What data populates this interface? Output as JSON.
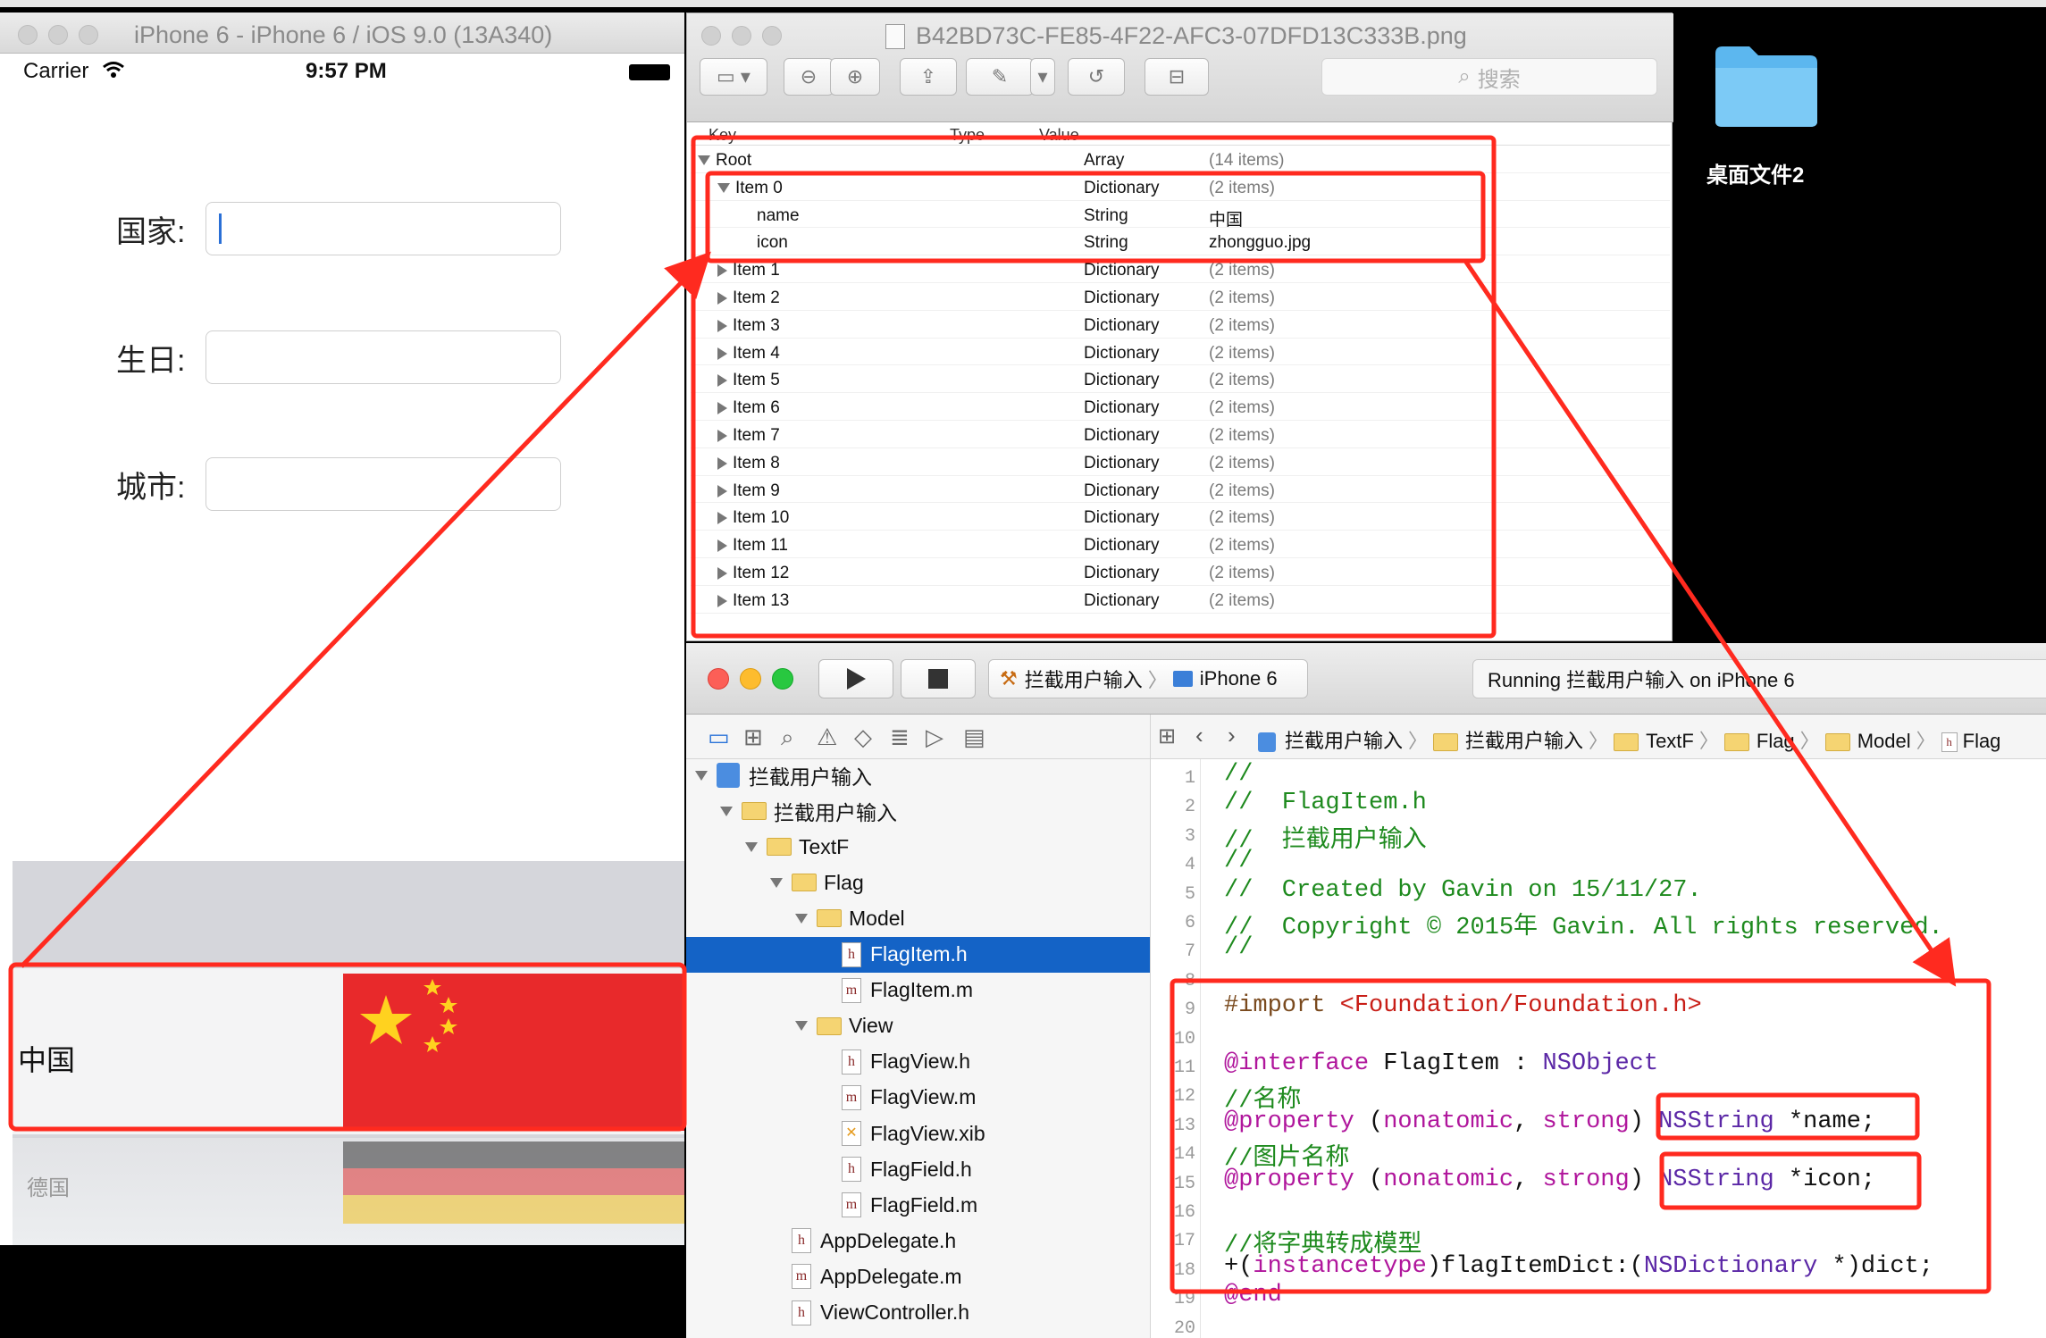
{
  "simulator": {
    "title": "iPhone 6 - iPhone 6 / iOS 9.0 (13A340)",
    "status": {
      "carrier": "Carrier",
      "time": "9:57 PM"
    },
    "form": [
      {
        "label": "国家:",
        "value": ""
      },
      {
        "label": "生日:",
        "value": ""
      },
      {
        "label": "城市:",
        "value": ""
      }
    ],
    "picker": {
      "selected_label": "中国",
      "next_label": "德国"
    }
  },
  "plist_viewer": {
    "filename": "B42BD73C-FE85-4F22-AFC3-07DFD13C333B.png",
    "search_placeholder": "搜索",
    "columns": {
      "key": "Key",
      "type": "Type",
      "value": "Value"
    },
    "rows": [
      {
        "key": "Root",
        "type": "Array",
        "value": "(14 items)",
        "depth": 0,
        "toggle": "open"
      },
      {
        "key": "Item 0",
        "type": "Dictionary",
        "value": "(2 items)",
        "depth": 1,
        "toggle": "open"
      },
      {
        "key": "name",
        "type": "String",
        "value": "中国",
        "depth": 2,
        "toggle": "none"
      },
      {
        "key": "icon",
        "type": "String",
        "value": "zhongguo.jpg",
        "depth": 2,
        "toggle": "none"
      },
      {
        "key": "Item 1",
        "type": "Dictionary",
        "value": "(2 items)",
        "depth": 1,
        "toggle": "closed"
      },
      {
        "key": "Item 2",
        "type": "Dictionary",
        "value": "(2 items)",
        "depth": 1,
        "toggle": "closed"
      },
      {
        "key": "Item 3",
        "type": "Dictionary",
        "value": "(2 items)",
        "depth": 1,
        "toggle": "closed"
      },
      {
        "key": "Item 4",
        "type": "Dictionary",
        "value": "(2 items)",
        "depth": 1,
        "toggle": "closed"
      },
      {
        "key": "Item 5",
        "type": "Dictionary",
        "value": "(2 items)",
        "depth": 1,
        "toggle": "closed"
      },
      {
        "key": "Item 6",
        "type": "Dictionary",
        "value": "(2 items)",
        "depth": 1,
        "toggle": "closed"
      },
      {
        "key": "Item 7",
        "type": "Dictionary",
        "value": "(2 items)",
        "depth": 1,
        "toggle": "closed"
      },
      {
        "key": "Item 8",
        "type": "Dictionary",
        "value": "(2 items)",
        "depth": 1,
        "toggle": "closed"
      },
      {
        "key": "Item 9",
        "type": "Dictionary",
        "value": "(2 items)",
        "depth": 1,
        "toggle": "closed"
      },
      {
        "key": "Item 10",
        "type": "Dictionary",
        "value": "(2 items)",
        "depth": 1,
        "toggle": "closed"
      },
      {
        "key": "Item 11",
        "type": "Dictionary",
        "value": "(2 items)",
        "depth": 1,
        "toggle": "closed"
      },
      {
        "key": "Item 12",
        "type": "Dictionary",
        "value": "(2 items)",
        "depth": 1,
        "toggle": "closed"
      },
      {
        "key": "Item 13",
        "type": "Dictionary",
        "value": "(2 items)",
        "depth": 1,
        "toggle": "closed"
      }
    ]
  },
  "desktop": {
    "folder_label": "桌面文件2"
  },
  "xcode": {
    "scheme": {
      "project": "拦截用户输入",
      "device": "iPhone 6"
    },
    "activity": "Running 拦截用户输入 on iPhone 6",
    "jump_bar": [
      "拦截用户输入",
      "拦截用户输入",
      "TextF",
      "Flag",
      "Model",
      "Flag"
    ],
    "navigator": [
      {
        "label": "拦截用户输入",
        "kind": "project",
        "depth": 0,
        "toggle": "open",
        "selected": false
      },
      {
        "label": "拦截用户输入",
        "kind": "folder",
        "depth": 1,
        "toggle": "open",
        "selected": false
      },
      {
        "label": "TextF",
        "kind": "folder",
        "depth": 2,
        "toggle": "open",
        "selected": false
      },
      {
        "label": "Flag",
        "kind": "folder",
        "depth": 3,
        "toggle": "open",
        "selected": false
      },
      {
        "label": "Model",
        "kind": "folder",
        "depth": 4,
        "toggle": "open",
        "selected": false
      },
      {
        "label": "FlagItem.h",
        "kind": "h",
        "depth": 5,
        "toggle": "none",
        "selected": true
      },
      {
        "label": "FlagItem.m",
        "kind": "m",
        "depth": 5,
        "toggle": "none",
        "selected": false
      },
      {
        "label": "View",
        "kind": "folder",
        "depth": 4,
        "toggle": "open",
        "selected": false
      },
      {
        "label": "FlagView.h",
        "kind": "h",
        "depth": 5,
        "toggle": "none",
        "selected": false
      },
      {
        "label": "FlagView.m",
        "kind": "m",
        "depth": 5,
        "toggle": "none",
        "selected": false
      },
      {
        "label": "FlagView.xib",
        "kind": "xib",
        "depth": 5,
        "toggle": "none",
        "selected": false
      },
      {
        "label": "FlagField.h",
        "kind": "h",
        "depth": 5,
        "toggle": "none",
        "selected": false
      },
      {
        "label": "FlagField.m",
        "kind": "m",
        "depth": 5,
        "toggle": "none",
        "selected": false
      },
      {
        "label": "AppDelegate.h",
        "kind": "h",
        "depth": 3,
        "toggle": "none",
        "selected": false
      },
      {
        "label": "AppDelegate.m",
        "kind": "m",
        "depth": 3,
        "toggle": "none",
        "selected": false
      },
      {
        "label": "ViewController.h",
        "kind": "h",
        "depth": 3,
        "toggle": "none",
        "selected": false
      }
    ],
    "code": [
      {
        "n": "1",
        "parts": [
          [
            "c-com",
            "//"
          ]
        ]
      },
      {
        "n": "2",
        "parts": [
          [
            "c-com",
            "//  FlagItem.h"
          ]
        ]
      },
      {
        "n": "3",
        "parts": [
          [
            "c-com",
            "//  拦截用户输入"
          ]
        ]
      },
      {
        "n": "4",
        "parts": [
          [
            "c-com",
            "//"
          ]
        ]
      },
      {
        "n": "5",
        "parts": [
          [
            "c-com",
            "//  Created by Gavin on 15/11/27."
          ]
        ]
      },
      {
        "n": "6",
        "parts": [
          [
            "c-com",
            "//  Copyright © 2015年 Gavin. All rights reserved."
          ]
        ]
      },
      {
        "n": "7",
        "parts": [
          [
            "c-com",
            "//"
          ]
        ]
      },
      {
        "n": "8",
        "parts": []
      },
      {
        "n": "9",
        "parts": [
          [
            "c-pre",
            "#import "
          ],
          [
            "c-str",
            "<Foundation/Foundation.h>"
          ]
        ]
      },
      {
        "n": "10",
        "parts": []
      },
      {
        "n": "11",
        "parts": [
          [
            "c-kw",
            "@interface"
          ],
          [
            "c-plain",
            " FlagItem : "
          ],
          [
            "c-cls",
            "NSObject"
          ]
        ]
      },
      {
        "n": "12",
        "parts": [
          [
            "c-com",
            "//名称"
          ]
        ]
      },
      {
        "n": "13",
        "parts": [
          [
            "c-kw",
            "@property"
          ],
          [
            "c-plain",
            " ("
          ],
          [
            "c-kw",
            "nonatomic"
          ],
          [
            "c-plain",
            ", "
          ],
          [
            "c-kw",
            "strong"
          ],
          [
            "c-plain",
            ") "
          ],
          [
            "c-cls",
            "NSString"
          ],
          [
            "c-plain",
            " *name;"
          ]
        ]
      },
      {
        "n": "14",
        "parts": [
          [
            "c-com",
            "//图片名称"
          ]
        ]
      },
      {
        "n": "15",
        "parts": [
          [
            "c-kw",
            "@property"
          ],
          [
            "c-plain",
            " ("
          ],
          [
            "c-kw",
            "nonatomic"
          ],
          [
            "c-plain",
            ", "
          ],
          [
            "c-kw",
            "strong"
          ],
          [
            "c-plain",
            ") "
          ],
          [
            "c-cls",
            "NSString"
          ],
          [
            "c-plain",
            " *icon;"
          ]
        ]
      },
      {
        "n": "16",
        "parts": []
      },
      {
        "n": "17",
        "parts": [
          [
            "c-com",
            "//将字典转成模型"
          ]
        ]
      },
      {
        "n": "18",
        "parts": [
          [
            "c-plain",
            "+("
          ],
          [
            "c-kw",
            "instancetype"
          ],
          [
            "c-plain",
            ")flagItemDict:("
          ],
          [
            "c-cls",
            "NSDictionary"
          ],
          [
            "c-plain",
            " *)dict;"
          ]
        ]
      },
      {
        "n": "19",
        "parts": [
          [
            "c-kw",
            "@end"
          ]
        ]
      },
      {
        "n": "20",
        "parts": []
      }
    ]
  },
  "annotation_color": "#ff2a1f"
}
